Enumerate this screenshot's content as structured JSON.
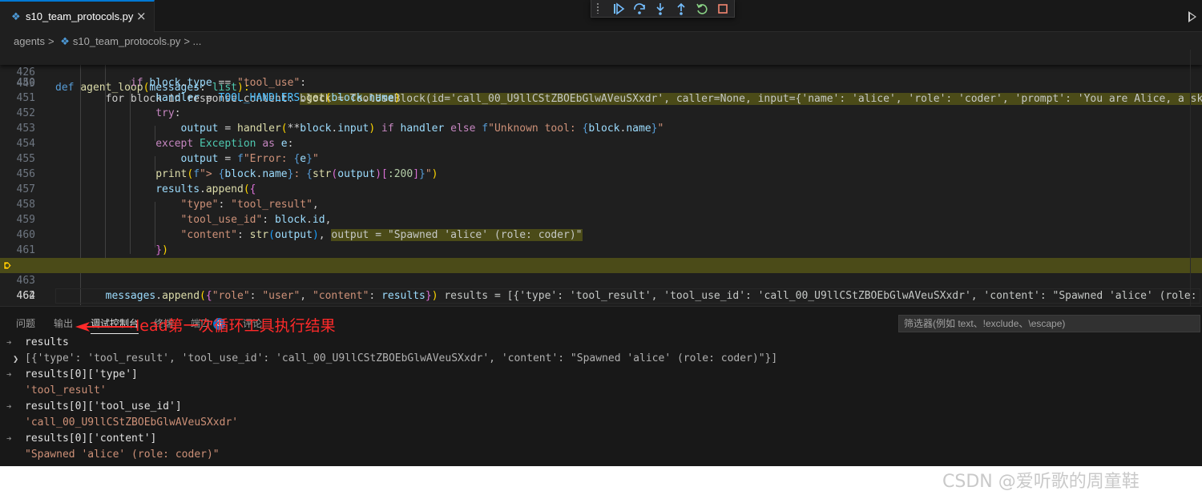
{
  "tab": {
    "icon": "python-file-icon",
    "filename": "s10_team_protocols.py",
    "close": "×"
  },
  "breadcrumb": {
    "folder": "agents",
    "sep": ">",
    "file": "s10_team_protocols.py",
    "tail": "> ..."
  },
  "debug_toolbar": [
    "continue-icon",
    "step-over-icon",
    "step-into-icon",
    "step-out-icon",
    "restart-icon",
    "stop-icon"
  ],
  "editor": {
    "sticky_line": "426",
    "sticky_def": "def",
    "sticky_fn": "agent_loop",
    "sticky_rest_a": "(",
    "sticky_param": "messages",
    "sticky_rest_b": ": ",
    "sticky_type": "list",
    "sticky_rest_c": "):",
    "line_449": "449",
    "line_449_code": "        for block in response.content: ",
    "line_449_inline": "block = ToolUseBlock(id='call_00_U9llCStZBOEbGlwAVeuSXxdr', caller=None, input={'name': 'alice', 'role': 'coder', 'prompt': 'You are Alice, a skill",
    "lines": {
      "l450": "450",
      "l451": "451",
      "l452": "452",
      "l453": "453",
      "l454": "454",
      "l455": "455",
      "l456": "456",
      "l457": "457",
      "l458": "458",
      "l459": "459",
      "l460": "460",
      "l461": "461",
      "l462": "462",
      "l463": "463",
      "l464": "464"
    },
    "inline_460": "output = \"Spawned 'alice' (role: coder)\"",
    "inline_462": "results = [{'type': 'tool_result', 'tool_use_id': 'call_00_U9llCStZBOEbGlwAVeuSXxdr', 'content': \"Spawned 'alice' (role: coder)\"}]"
  },
  "panel": {
    "tabs": [
      "问题",
      "输出",
      "调试控制台",
      "终端",
      "端口",
      "评论"
    ],
    "ports_badge": "3",
    "filter_placeholder": "筛选器(例如 text、!exclude、\\escape)",
    "console": [
      {
        "kind": "in",
        "text": "results"
      },
      {
        "kind": "out-expand",
        "text": "[{'type': 'tool_result', 'tool_use_id': 'call_00_U9llCStZBOEbGlwAVeuSXxdr', 'content': \"Spawned 'alice' (role: coder)\"}]"
      },
      {
        "kind": "in",
        "text": "results[0]['type']"
      },
      {
        "kind": "out",
        "text": "'tool_result'"
      },
      {
        "kind": "in",
        "text": "results[0]['tool_use_id']"
      },
      {
        "kind": "out",
        "text": "'call_00_U9llCStZBOEbGlwAVeuSXxdr'"
      },
      {
        "kind": "in",
        "text": "results[0]['content']"
      },
      {
        "kind": "out",
        "text": "\"Spawned 'alice' (role: coder)\""
      }
    ]
  },
  "annotation": {
    "text": "lead第一次循环工具执行结果",
    "color": "#ff2a2a"
  },
  "watermark": "CSDN @爱听歌的周童鞋",
  "colors": {
    "accent": "#0078d4",
    "highlight": "#4b4b18",
    "background": "#1f1f1f"
  }
}
